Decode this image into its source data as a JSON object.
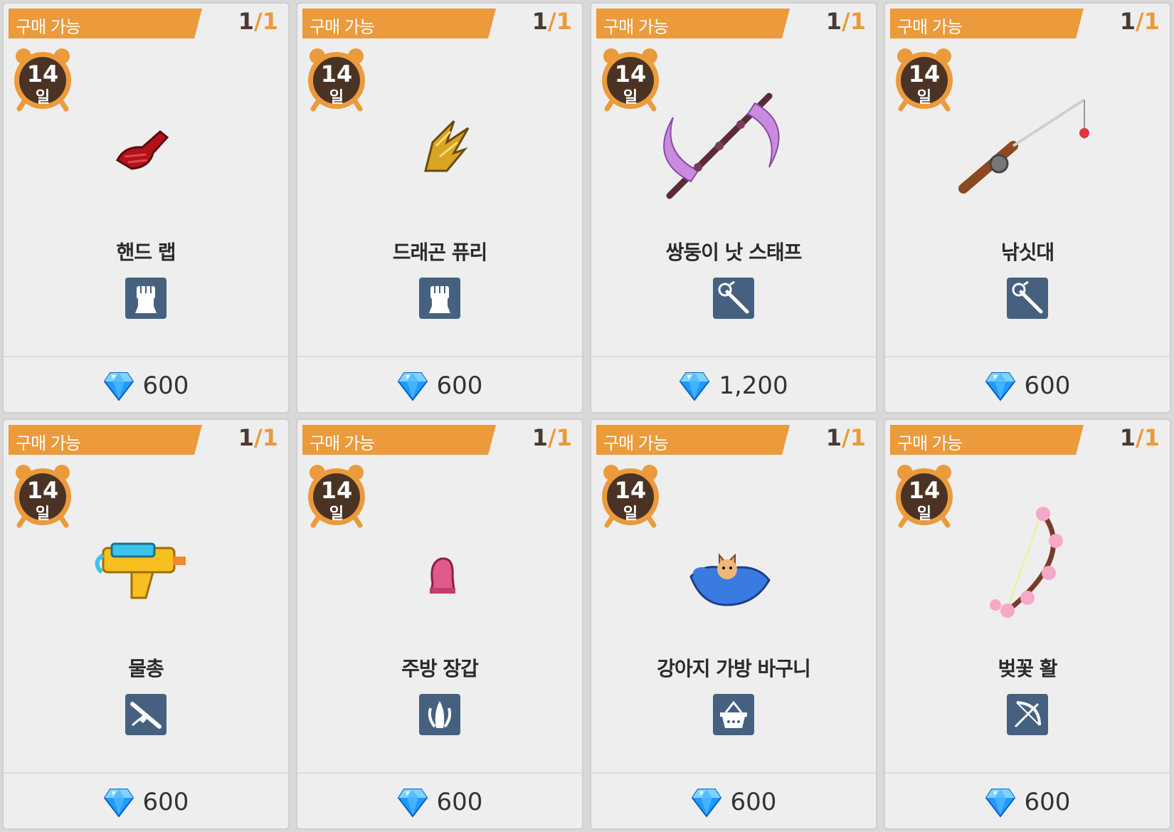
{
  "colors": {
    "banner": "#eb9a3c",
    "card_bg": "#eeeeee",
    "type_icon_bg": "#46617f",
    "gem": "#1e9bff",
    "clock_face": "#4a3324"
  },
  "items": [
    {
      "banner_label": "구매 가능",
      "qty_current": "1",
      "qty_sep": "/",
      "qty_max": "1",
      "days": "14",
      "days_unit": "일",
      "name": "핸드 랩",
      "image_icon": "hand-wrap-icon",
      "type_icon": "fist-icon",
      "currency_icon": "diamond-gem-icon",
      "price": "600"
    },
    {
      "banner_label": "구매 가능",
      "qty_current": "1",
      "qty_sep": "/",
      "qty_max": "1",
      "days": "14",
      "days_unit": "일",
      "name": "드래곤 퓨리",
      "image_icon": "dragon-claw-icon",
      "type_icon": "fist-icon",
      "currency_icon": "diamond-gem-icon",
      "price": "600"
    },
    {
      "banner_label": "구매 가능",
      "qty_current": "1",
      "qty_sep": "/",
      "qty_max": "1",
      "days": "14",
      "days_unit": "일",
      "name": "쌍둥이 낫 스태프",
      "image_icon": "twin-scythe-staff-icon",
      "type_icon": "staff-icon",
      "currency_icon": "diamond-gem-icon",
      "price": "1,200"
    },
    {
      "banner_label": "구매 가능",
      "qty_current": "1",
      "qty_sep": "/",
      "qty_max": "1",
      "days": "14",
      "days_unit": "일",
      "name": "낚싯대",
      "image_icon": "fishing-rod-icon",
      "type_icon": "staff-icon",
      "currency_icon": "diamond-gem-icon",
      "price": "600"
    },
    {
      "banner_label": "구매 가능",
      "qty_current": "1",
      "qty_sep": "/",
      "qty_max": "1",
      "days": "14",
      "days_unit": "일",
      "name": "물총",
      "image_icon": "water-gun-icon",
      "type_icon": "rifle-icon",
      "currency_icon": "diamond-gem-icon",
      "price": "600"
    },
    {
      "banner_label": "구매 가능",
      "qty_current": "1",
      "qty_sep": "/",
      "qty_max": "1",
      "days": "14",
      "days_unit": "일",
      "name": "주방 장갑",
      "image_icon": "kitchen-glove-icon",
      "type_icon": "claw-icon",
      "currency_icon": "diamond-gem-icon",
      "price": "600"
    },
    {
      "banner_label": "구매 가능",
      "qty_current": "1",
      "qty_sep": "/",
      "qty_max": "1",
      "days": "14",
      "days_unit": "일",
      "name": "강아지 가방 바구니",
      "image_icon": "puppy-bag-basket-icon",
      "type_icon": "basket-icon",
      "currency_icon": "diamond-gem-icon",
      "price": "600"
    },
    {
      "banner_label": "구매 가능",
      "qty_current": "1",
      "qty_sep": "/",
      "qty_max": "1",
      "days": "14",
      "days_unit": "일",
      "name": "벚꽃 활",
      "image_icon": "cherry-blossom-bow-icon",
      "type_icon": "bow-icon",
      "currency_icon": "diamond-gem-icon",
      "price": "600"
    }
  ]
}
